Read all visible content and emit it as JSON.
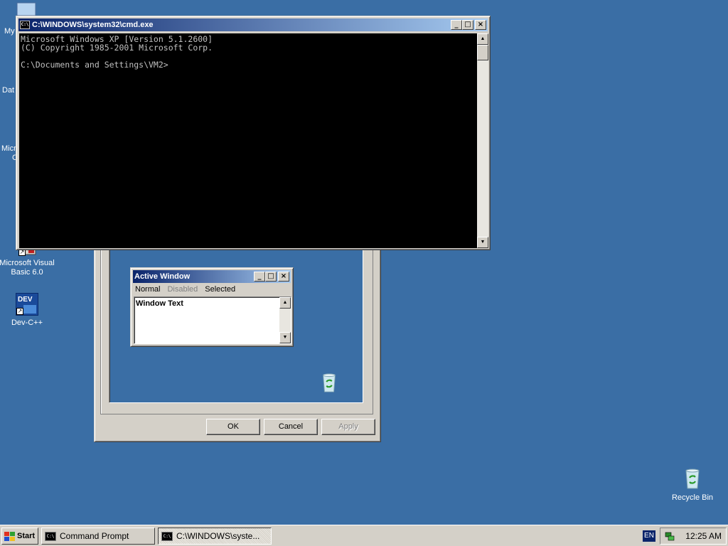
{
  "desktop": {
    "icons": [
      {
        "label": "Microsoft Visual Basic 6.0",
        "icon": "visual-basic-icon"
      },
      {
        "label": "Dev-C++",
        "icon": "devcpp-icon",
        "glyph_text": "DEV"
      },
      {
        "label": "Recycle Bin",
        "icon": "recycle-bin-icon"
      }
    ],
    "partial_labels": [
      "My",
      "Dat",
      "Micro",
      "C"
    ]
  },
  "cmd_window": {
    "title": "C:\\WINDOWS\\system32\\cmd.exe",
    "icon_text": "C:\\",
    "lines": [
      "Microsoft Windows XP [Version 5.1.2600]",
      "(C) Copyright 1985-2001 Microsoft Corp.",
      "",
      "C:\\Documents and Settings\\VM2>"
    ]
  },
  "appearance_dialog": {
    "buttons": {
      "ok": "OK",
      "cancel": "Cancel",
      "apply": "Apply"
    }
  },
  "sample_window": {
    "title": "Active Window",
    "menu": {
      "normal": "Normal",
      "disabled": "Disabled",
      "selected": "Selected"
    },
    "text": "Window Text"
  },
  "taskbar": {
    "start_label": "Start",
    "tasks": [
      {
        "label": "Command Prompt",
        "active": false
      },
      {
        "label": "C:\\WINDOWS\\syste...",
        "active": true
      }
    ],
    "language": "EN",
    "clock": "12:25 AM"
  },
  "colors": {
    "desktop": "#3a6ea5",
    "title_active_start": "#0a246a",
    "title_active_end": "#a6caf0",
    "face": "#d4d0c8"
  }
}
